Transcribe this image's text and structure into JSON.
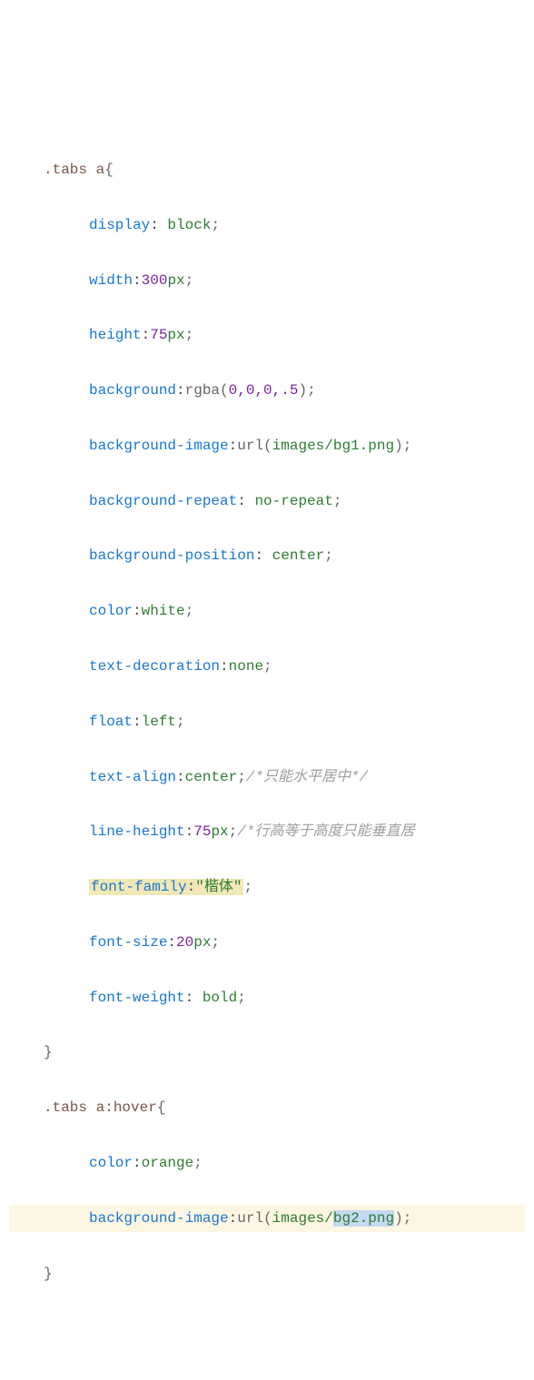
{
  "code": {
    "selector1": ".tabs a",
    "brace_open": "{",
    "brace_close": "}",
    "rule1": {
      "prop": "display",
      "val": "block"
    },
    "rule2": {
      "prop": "width",
      "num": "300",
      "unit": "px"
    },
    "rule3": {
      "prop": "height",
      "num": "75",
      "unit": "px"
    },
    "rule4": {
      "prop": "background",
      "func": "rgba",
      "args": "0,0,0,.5"
    },
    "rule5": {
      "prop": "background-image",
      "func": "url",
      "args": "images/bg1.png"
    },
    "rule6": {
      "prop": "background-repeat",
      "val": "no-repeat"
    },
    "rule7": {
      "prop": "background-position",
      "val": "center"
    },
    "rule8": {
      "prop": "color",
      "val": "white"
    },
    "rule9": {
      "prop": "text-decoration",
      "val": "none"
    },
    "rule10": {
      "prop": "float",
      "val": "left"
    },
    "rule11": {
      "prop": "text-align",
      "val": "center",
      "comment": "/*只能水平居中*/"
    },
    "rule12": {
      "prop": "line-height",
      "num": "75",
      "unit": "px",
      "comment": "/*行高等于高度只能垂直居"
    },
    "rule13": {
      "prop": "font-family",
      "val": "\"楷体\""
    },
    "rule14": {
      "prop": "font-size",
      "num": "20",
      "unit": "px"
    },
    "rule15": {
      "prop": "font-weight",
      "val": "bold"
    },
    "selector2": ".tabs a:hover",
    "rule16": {
      "prop": "color",
      "val": "orange"
    },
    "rule17": {
      "prop": "background-image",
      "func": "url",
      "args_pre": "images/",
      "args_sel": "bg2.png"
    }
  }
}
